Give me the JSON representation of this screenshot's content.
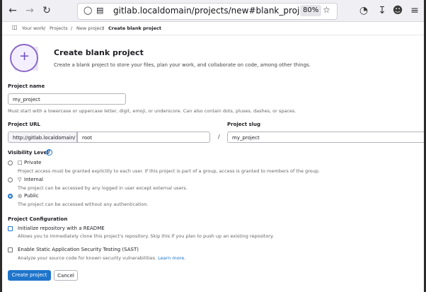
{
  "browser": {
    "url": "gitlab.localdomain/projects/new#blank_project",
    "zoom": "80%"
  },
  "breadcrumbs": [
    "Your work",
    "Projects",
    "New project",
    "Create blank project"
  ],
  "header": {
    "title": "Create blank project",
    "description": "Create a blank project to store your files, plan your work, and collaborate on code, among other things."
  },
  "project_name": {
    "label": "Project name",
    "value": "my_project",
    "help": "Must start with a lowercase or uppercase letter, digit, emoji, or underscore. Can also contain dots, pluses, dashes, or spaces."
  },
  "project_url": {
    "label": "Project URL",
    "prefix": "http://gitlab.localdomain/",
    "namespace": "root",
    "separator": "/"
  },
  "project_slug": {
    "label": "Project slug",
    "value": "my_project"
  },
  "visibility": {
    "label": "Visibility Level",
    "options": [
      {
        "title": "Private",
        "desc": "Project access must be granted explicitly to each user. If this project is part of a group, access is granted to members of the group."
      },
      {
        "title": "Internal",
        "desc": "The project can be accessed by any logged in user except external users."
      },
      {
        "title": "Public",
        "desc": "The project can be accessed without any authentication."
      }
    ],
    "selected": "Public"
  },
  "config": {
    "label": "Project Configuration",
    "readme_title": "Initialize repository with a README",
    "readme_desc": "Allows you to immediately clone this project's repository. Skip this if you plan to push up an existing repository.",
    "sast_title": "Enable Static Application Security Testing (SAST)",
    "sast_desc": "Analyze your source code for known security vulnerabilities.",
    "learn_more": "Learn more."
  },
  "actions": {
    "create": "Create project",
    "cancel": "Cancel"
  },
  "colors": {
    "accent": "#1f75cb",
    "hero": "#8b68c9"
  }
}
